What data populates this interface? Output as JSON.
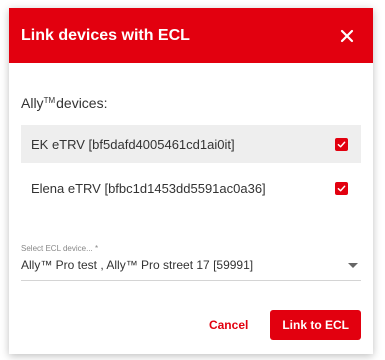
{
  "dialog": {
    "title": "Link devices with ECL",
    "close_icon": "close-icon",
    "accent_color": "#e2000f"
  },
  "devices_section": {
    "brand": "Ally",
    "trademark": "TM",
    "label_suffix": " devices:",
    "items": [
      {
        "label": "EK eTRV [bf5dafd4005461cd1ai0it]",
        "checked": true,
        "highlighted": true
      },
      {
        "label": "Elena eTRV [bfbc1d1453dd5591ac0a36]",
        "checked": true,
        "highlighted": false
      }
    ]
  },
  "ecl_select": {
    "label": "Select ECL device... *",
    "value": "Ally™ Pro test , Ally™ Pro street 17 [59991]",
    "arrow_icon": "dropdown-arrow-icon"
  },
  "footer": {
    "cancel_label": "Cancel",
    "link_label": "Link to ECL"
  }
}
